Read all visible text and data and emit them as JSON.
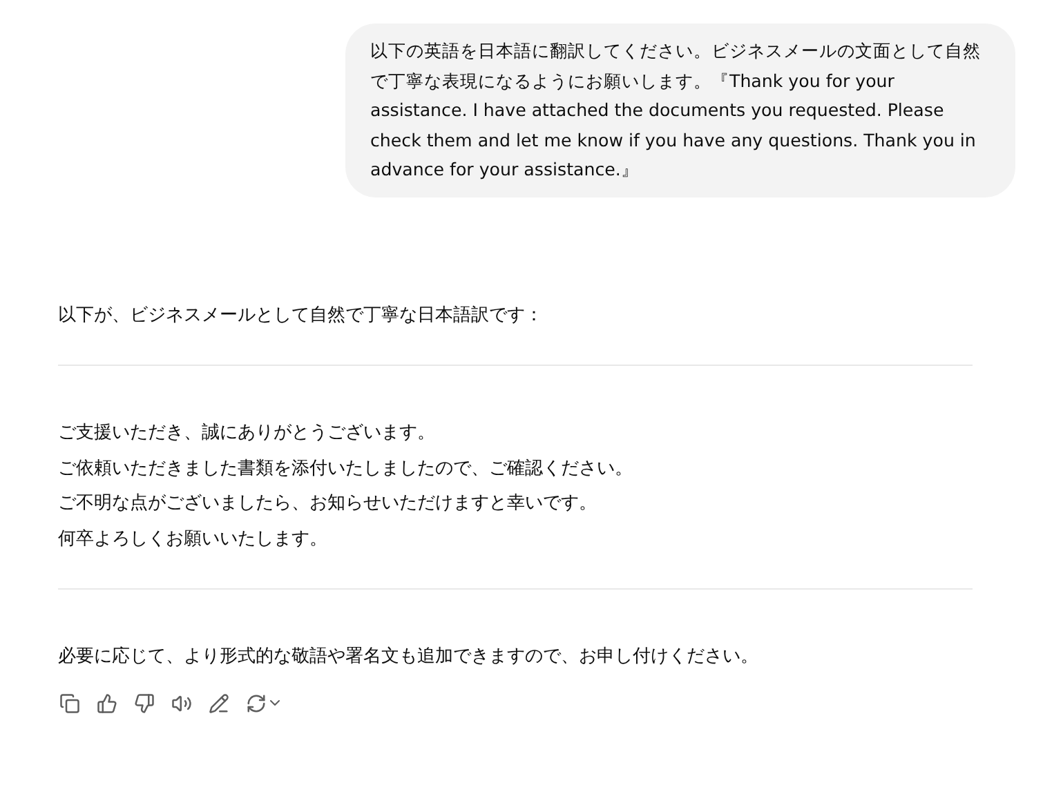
{
  "user_message": "以下の英語を日本語に翻訳してください。ビジネスメールの文面として自然で丁寧な表現になるようにお願いします。『Thank you for your assistance. I have attached the documents you requested. Please check them and let me know if you have any questions. Thank you in advance for your assistance.』",
  "reply": {
    "intro": "以下が、ビジネスメールとして自然で丁寧な日本語訳です：",
    "translation_lines": [
      "ご支援いただき、誠にありがとうございます。",
      "ご依頼いただきました書類を添付いたしましたので、ご確認ください。",
      "ご不明な点がございましたら、お知らせいただけますと幸いです。",
      "何卒よろしくお願いいたします。"
    ],
    "closing": "必要に応じて、より形式的な敬語や署名文も追加できますので、お申し付けください。"
  }
}
